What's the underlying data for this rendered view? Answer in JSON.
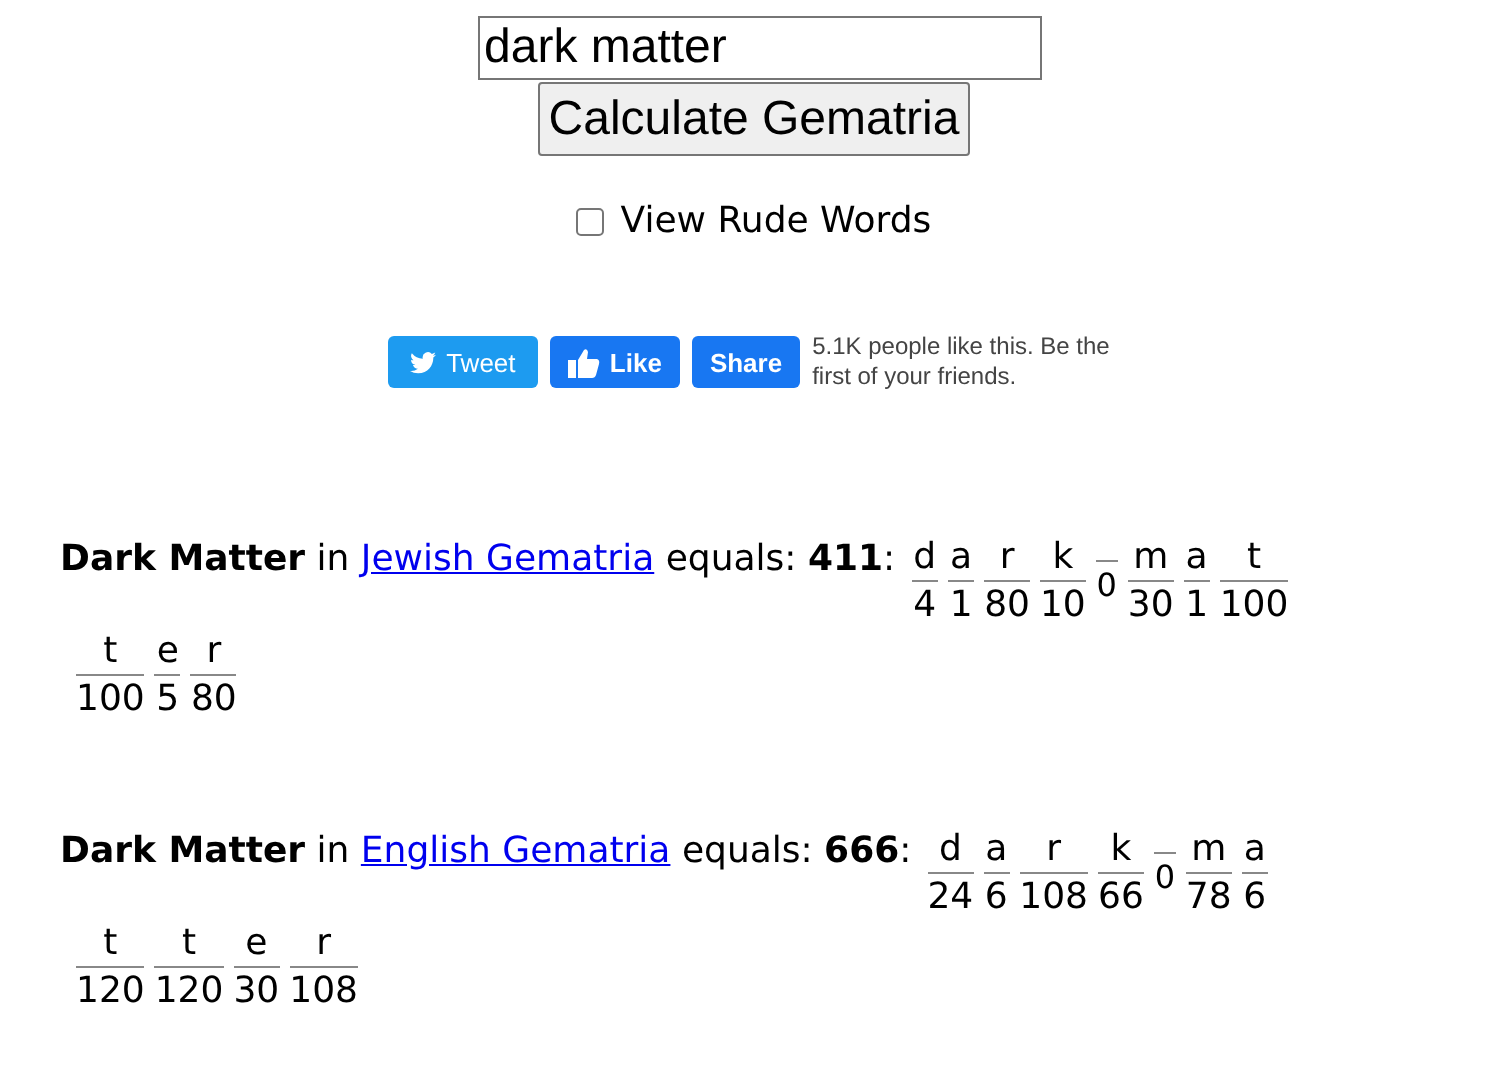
{
  "search": {
    "value": "dark matter"
  },
  "calculate_button": "Calculate Gematria",
  "rude_words": {
    "label": "View Rude Words",
    "checked": false
  },
  "social": {
    "tweet": "Tweet",
    "like": "Like",
    "share": "Share",
    "like_text": "5.1K people like this. Be the first of your friends."
  },
  "results": [
    {
      "phrase": "Dark Matter",
      "in": "in",
      "cipher": "Jewish Gematria",
      "equals": "equals:",
      "total": "411",
      "colon": ":",
      "rows": [
        [
          {
            "letter": "d",
            "value": "4",
            "kind": "letter"
          },
          {
            "letter": "a",
            "value": "1",
            "kind": "letter"
          },
          {
            "letter": "r",
            "value": "80",
            "kind": "letter"
          },
          {
            "letter": "k",
            "value": "10",
            "kind": "letter"
          },
          {
            "value": "0",
            "kind": "space"
          },
          {
            "letter": "m",
            "value": "30",
            "kind": "letter"
          },
          {
            "letter": "a",
            "value": "1",
            "kind": "letter"
          },
          {
            "letter": "t",
            "value": "100",
            "kind": "letter"
          }
        ],
        [
          {
            "letter": "t",
            "value": "100",
            "kind": "letter"
          },
          {
            "letter": "e",
            "value": "5",
            "kind": "letter"
          },
          {
            "letter": "r",
            "value": "80",
            "kind": "letter"
          }
        ]
      ]
    },
    {
      "phrase": "Dark Matter",
      "in": "in",
      "cipher": "English Gematria",
      "equals": "equals:",
      "total": "666",
      "colon": ":",
      "rows": [
        [
          {
            "letter": "d",
            "value": "24",
            "kind": "letter"
          },
          {
            "letter": "a",
            "value": "6",
            "kind": "letter"
          },
          {
            "letter": "r",
            "value": "108",
            "kind": "letter"
          },
          {
            "letter": "k",
            "value": "66",
            "kind": "letter"
          },
          {
            "value": "0",
            "kind": "space"
          },
          {
            "letter": "m",
            "value": "78",
            "kind": "letter"
          },
          {
            "letter": "a",
            "value": "6",
            "kind": "letter"
          }
        ],
        [
          {
            "letter": "t",
            "value": "120",
            "kind": "letter"
          },
          {
            "letter": "t",
            "value": "120",
            "kind": "letter"
          },
          {
            "letter": "e",
            "value": "30",
            "kind": "letter"
          },
          {
            "letter": "r",
            "value": "108",
            "kind": "letter"
          }
        ]
      ]
    }
  ]
}
